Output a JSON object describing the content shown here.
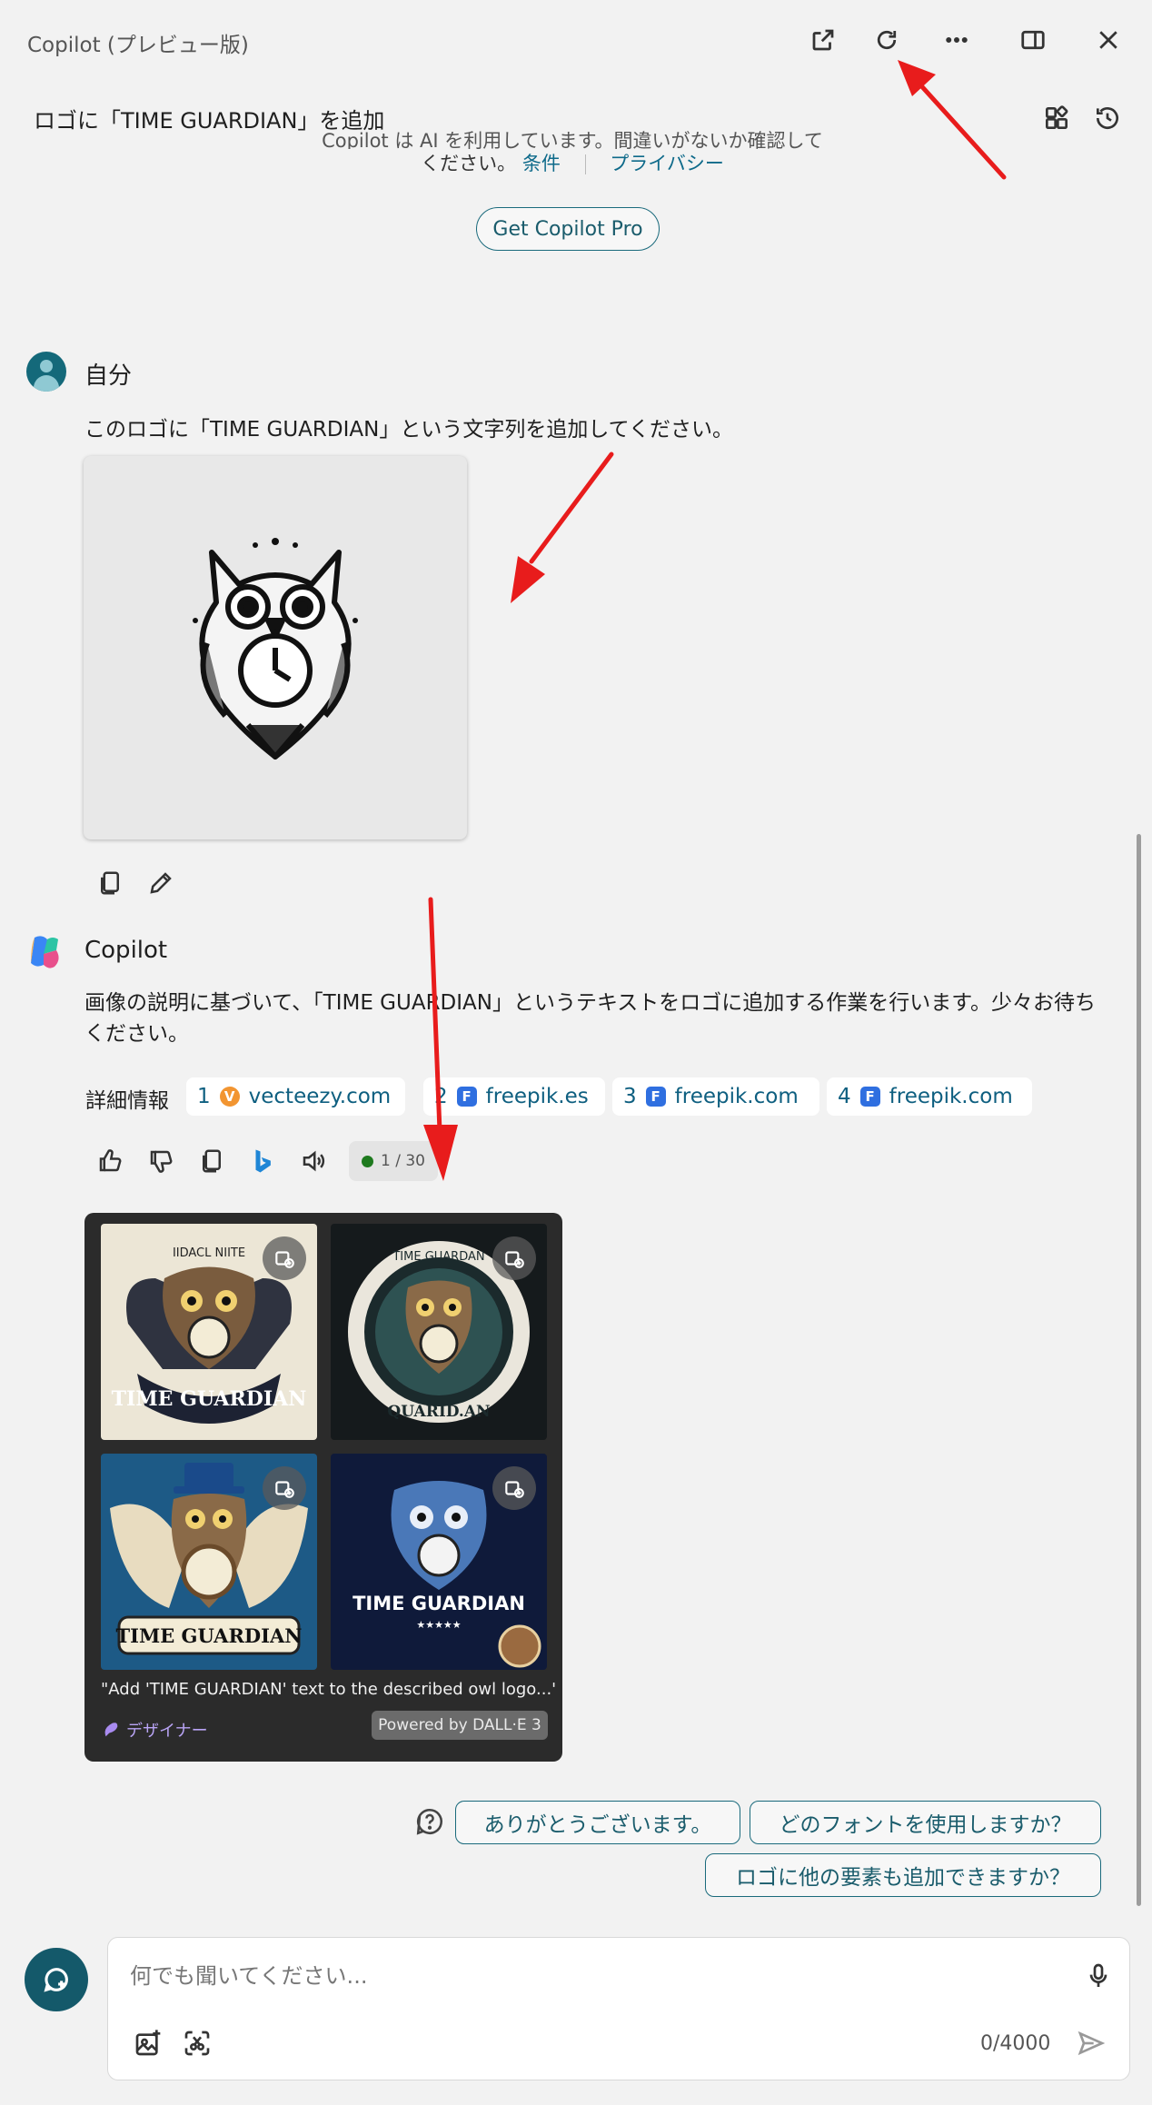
{
  "window": {
    "title": "Copilot (プレビュー版)",
    "icons": [
      "open-external-icon",
      "refresh-icon",
      "more-icon",
      "side-panel-icon",
      "close-icon"
    ]
  },
  "header": {
    "conversation_title": "ロゴに「TIME GUARDIAN」を追加",
    "icons": [
      "plugins-icon",
      "history-icon"
    ]
  },
  "notice": {
    "clipped_line": "Copilot は AI を利用しています。間違いがないか確認して",
    "line_prefix": "ください。",
    "terms_link": "条件",
    "privacy_link": "プライバシー"
  },
  "pro_button": "Get Copilot Pro",
  "user_message": {
    "author": "自分",
    "text": "このロゴに「TIME GUARDIAN」という文字列を追加してください。"
  },
  "copilot_message": {
    "author": "Copilot",
    "text": "画像の説明に基づいて、「TIME GUARDIAN」というテキストをロゴに追加する作業を行います。少々お待ちください。",
    "learn_more_label": "詳細情報",
    "citations": [
      {
        "num": "1",
        "domain": "vecteezy.com",
        "favicon": "vecteezy-icon"
      },
      {
        "num": "2",
        "domain": "freepik.es",
        "favicon": "freepik-icon"
      },
      {
        "num": "3",
        "domain": "freepik.com",
        "favicon": "freepik-icon"
      },
      {
        "num": "4",
        "domain": "freepik.com",
        "favicon": "freepik-icon"
      }
    ],
    "counter": "1 / 30",
    "counter_color": "#1e7a1e"
  },
  "image_card": {
    "caption": "\"Add 'TIME GUARDIAN' text to the described owl logo...\"",
    "designer_label": "デザイナー",
    "powered_by": "Powered by DALL·E 3",
    "thumbnails": [
      {
        "text": "TIME GUARDIAN",
        "arc_text": "IIDACL NIITE"
      },
      {
        "text": "QUARID.AN",
        "arc_text": "TIME GUARDAN"
      },
      {
        "text": "TIME GUARDIAN"
      },
      {
        "text": "TIME GUARDIAN",
        "stars": "★★★★★"
      }
    ]
  },
  "suggestions": [
    "ありがとうございます。",
    "どのフォントを使用しますか？",
    "ロゴに他の要素も追加できますか？"
  ],
  "composer": {
    "placeholder": "何でも聞いてください...",
    "char_count": "0/4000"
  },
  "colors": {
    "accent": "#1a6a7c",
    "annotation_arrow": "#e81c1c",
    "background": "#f2f2f2"
  }
}
